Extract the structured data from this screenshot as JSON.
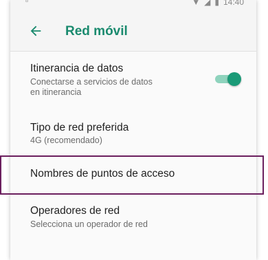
{
  "status_bar": {
    "time": "14:40"
  },
  "app_bar": {
    "title": "Red móvil"
  },
  "settings": [
    {
      "title": "Itinerancia de datos",
      "subtitle_line1": "Conectarse a servicios de datos",
      "subtitle_line2": "en itinerancia",
      "toggle_on": true
    },
    {
      "title": "Tipo de red preferida",
      "subtitle_line1": "4G (recomendado)"
    },
    {
      "title": "Nombres de puntos de acceso"
    },
    {
      "title": "Operadores de red",
      "subtitle_line1": "Selecciona un operador de red"
    }
  ],
  "colors": {
    "accent": "#1a8a6e",
    "highlight": "#6b1f5e"
  }
}
